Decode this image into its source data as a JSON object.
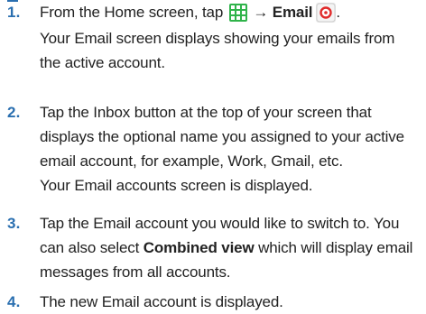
{
  "steps": [
    {
      "number": "1.",
      "before_icon": "From the Home screen, tap ",
      "arrow": "→",
      "target_label": "Email",
      "period": ".",
      "icons": [
        "apps-grid-icon",
        "email-icon"
      ],
      "note_line1": "Your Email screen displays showing your emails from",
      "note_line2": "the active account."
    },
    {
      "number": "2.",
      "line1": "Tap the Inbox button at the top of your screen that",
      "line2": "displays the optional name you assigned to your active",
      "line3": "email account, for example, Work, Gmail, etc.",
      "note": "Your Email accounts screen is displayed."
    },
    {
      "number": "3.",
      "line1": "Tap the Email account you would like to switch to. You",
      "line2_before": "can also select ",
      "line2_bold": "Combined view",
      "line2_after": " which will display email",
      "line3": "messages from all accounts."
    },
    {
      "number": "4.",
      "line1": "The new Email account is displayed."
    }
  ],
  "colors": {
    "step_number": "#2a6fb0",
    "apps_icon": "#2fb34a",
    "email_icon_ring": "#e02b2b"
  }
}
